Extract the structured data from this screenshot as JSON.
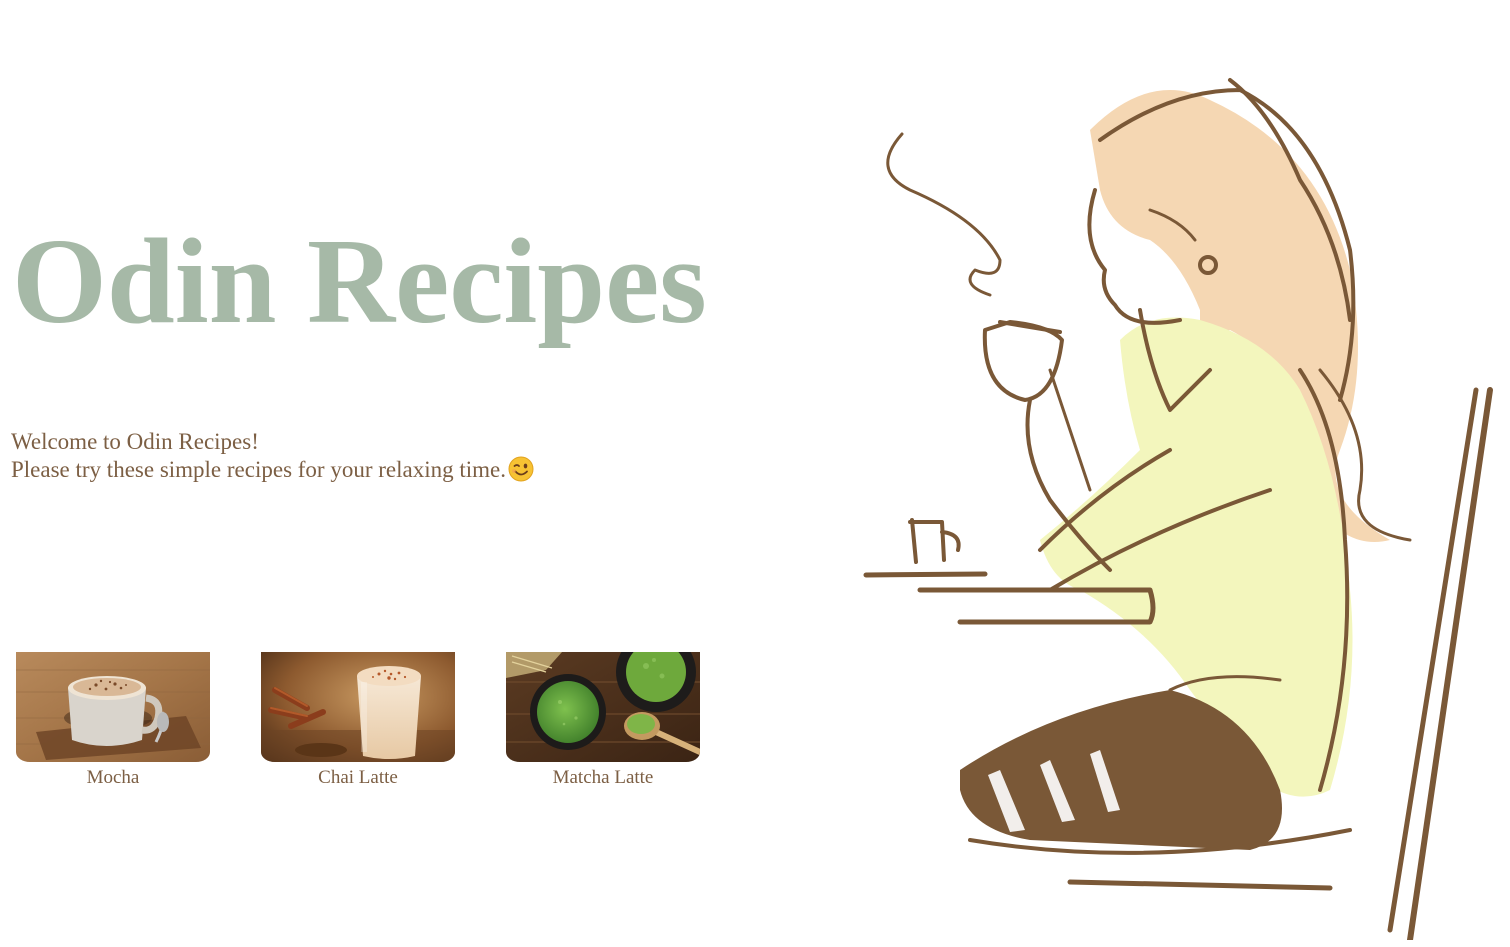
{
  "header": {
    "title": "Odin Recipes"
  },
  "intro": {
    "line1": "Welcome to Odin Recipes!",
    "line2": "Please try these simple recipes for your relaxing time.",
    "emoji_icon": "winking-face-icon"
  },
  "recipes": [
    {
      "label": "Mocha",
      "image": "mocha-photo"
    },
    {
      "label": "Chai Latte",
      "image": "chai-latte-photo"
    },
    {
      "label": "Matcha Latte",
      "image": "matcha-latte-photo"
    }
  ],
  "hero": {
    "image": "woman-drinking-coffee-illustration"
  },
  "colors": {
    "title": "#a6b9a7",
    "text": "#7c5f44",
    "sweater": "#f3f6bd",
    "hair": "#f5d7b3",
    "line": "#7a5837"
  }
}
